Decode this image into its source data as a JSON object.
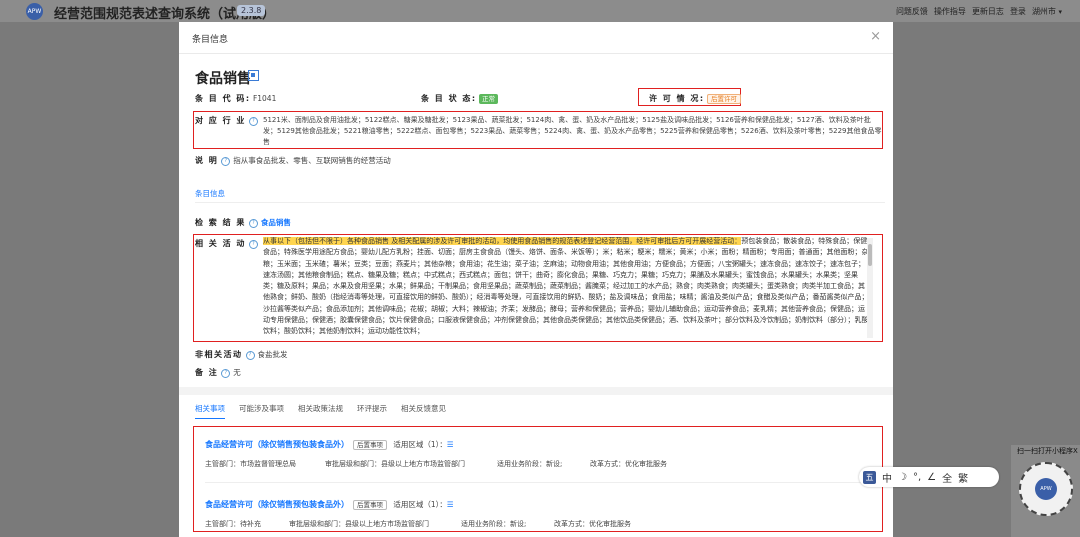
{
  "app": {
    "logo_text": "APW",
    "title": "经营范围规范表述查询系统（试用版）",
    "version": "2.3.8",
    "top_links": [
      "问题反馈",
      "操作指导",
      "更新日志",
      "登录",
      "湖州市"
    ],
    "city_arrow": "▾"
  },
  "modal": {
    "title": "条目信息",
    "close": "×",
    "name": "食品销售",
    "code_label": "条 目 代 码:",
    "code": "F1041",
    "status_label": "条 目 状 态:",
    "status": "正常",
    "permit_label": "许 可 情 况:",
    "permit": "后置许可",
    "industry_label": "对 应 行 业",
    "industry": "5121米、面制品及食用油批发；5122糕点、糖果及糖批发；5123果品、蔬菜批发；5124肉、禽、蛋、奶及水产品批发；5125盐及调味品批发；5126营养和保健品批发；5127酒、饮料及茶叶批发；5129其他食品批发；5221粮油零售；5222糕点、面包零售；5223果品、蔬菜零售；5224肉、禽、蛋、奶及水产品零售；5225营养和保健品零售；5226酒、饮料及茶叶零售；5229其他食品零售",
    "desc_label": "说 明",
    "desc": "指从事食品批发、零售、互联网销售的经营活动",
    "section_tab": "条目信息",
    "search_label": "检 索 结 果",
    "search_result": "食品销售",
    "activities_label": "相 关 活 动",
    "activities_highlight": "从事以下（包括但不限于）各种食品销售 及相关配属的涉及许可审批的活动，均使用食品销售的规范表述登记经营范围，经许可审批后方可开展经营活动：",
    "activities_rest": "预包装食品；散装食品；特殊食品；保健食品；特殊医学用途配方食品；婴幼儿配方乳粉；挂面、切面；厨房主食食品（馒头、烙饼、面条、米饭等）；米；粘米；粳米；糯米；黄米；小米；面粉；精面粉；专用面；普通面；其他面粉；杂粮；玉米面；玉米碴；薯米；豆类；豆面；燕麦片；其他杂粮；食用油；花生油；菜子油；芝麻油；动物食用油；其他食用油；方便食品；方便面；八宝粥罐头；速冻食品；速冻饺子；速冻包子；速冻汤圆；其他粮食制品；糕点、糖果及糖；糕点；中式糕点；西式糕点；面包；饼干；曲奇；膨化食品；果糖、巧克力；果糖；巧克力；果脯及水果罐头；蜜饯食品；水果罐头；水果类；坚果类；糖及原料；果品；水果及食用坚果；水果；鲜果品；干制果品；食用坚果品；蔬菜制品；蔬菜制品；酱腌菜；经过加工的水产品；熟食；肉类熟食；肉类罐头；蛋类熟食；肉类半加工食品；其他熟食；鲜奶、酸奶（指经消毒等处理，可直接饮用的鲜奶、酸奶）；经消毒等处理，可直接饮用的鲜奶、酸奶；盐及调味品；食用盐；味精；酱油及类似产品；食醋及类似产品；番茄酱类似产品；沙拉酱等类似产品；食品添加剂；其他调味品；花椒；胡椒；大料；辣椒油；芥茉；发酵品；酵母；营养和保健品；营养品；婴幼儿辅助食品；运动营养食品；麦乳精；其他营养食品；保健品；运动专用保健品；保健酒；胶囊保健食品；饮片保健食品；口服液保健食品；冲剂保健食品；其他食品类保健品；其他饮品类保健品；酒、饮料及茶叶；部分饮料及冷饮制品；奶制饮料（部分）；乳酸饮料；酸奶饮料；其他奶制饮料；运动功能性饮料；",
    "nonrelated_label": "非相关活动",
    "nonrelated": "食盐批发",
    "note_label": "备 注",
    "note": "无"
  },
  "tabs": [
    "相关事项",
    "可能涉及事项",
    "相关政策法规",
    "环评提示",
    "相关反馈意见"
  ],
  "cards": [
    {
      "title": "食品经营许可（除仅销售预包装食品外）",
      "tag": "后置事项",
      "scope": "适用区域（1）：",
      "dept": "主管部门：市场监督管理总局",
      "level": "审批层级和部门：县级以上地方市场监管部门",
      "stage": "适用业务阶段：新设;",
      "reform": "改革方式：优化审批服务"
    },
    {
      "title": "食品经营许可（除仅销售预包装食品外）",
      "tag": "后置事项",
      "scope": "适用区域（1）：",
      "dept": "主管部门：待补充",
      "level": "审批层级和部门：县级以上地方市场监管部门",
      "stage": "适用业务阶段：新设;",
      "reform": "改革方式：优化审批服务"
    }
  ],
  "mini_toolbar": [
    "中",
    "☽",
    "°,",
    "∠",
    "全",
    "繁"
  ],
  "wechat": {
    "label": "扫一扫打开小程序",
    "close": "X"
  }
}
